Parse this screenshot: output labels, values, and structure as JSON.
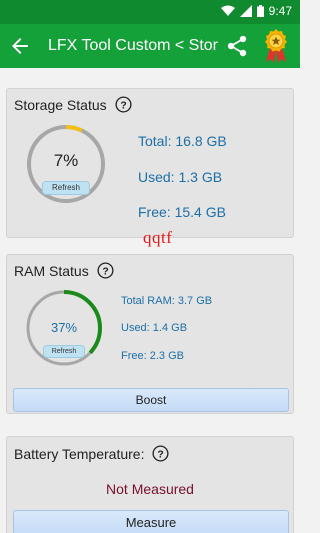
{
  "status_bar": {
    "time": "9:47"
  },
  "app_bar": {
    "title": "LFX Tool Custom < Stor"
  },
  "storage": {
    "title": "Storage Status",
    "percent_label": "7%",
    "percent_value": 7,
    "refresh_label": "Refresh",
    "total": "Total: 16.8 GB",
    "used": "Used: 1.3 GB",
    "free": "Free: 15.4 GB",
    "ring_color": "#f2c010"
  },
  "watermark": "qqtf",
  "ram": {
    "title": "RAM Status",
    "percent_label": "37%",
    "percent_value": 37,
    "refresh_label": "Refresh",
    "total": "Total RAM: 3.7 GB",
    "used": "Used: 1.4 GB",
    "free": "Free: 2.3 GB",
    "boost_label": "Boost",
    "ring_color": "#1b8a1b"
  },
  "battery": {
    "title": "Battery Temperature:",
    "value": "Not Measured",
    "value_color": "#7a0f2b",
    "measure_label": "Measure"
  }
}
